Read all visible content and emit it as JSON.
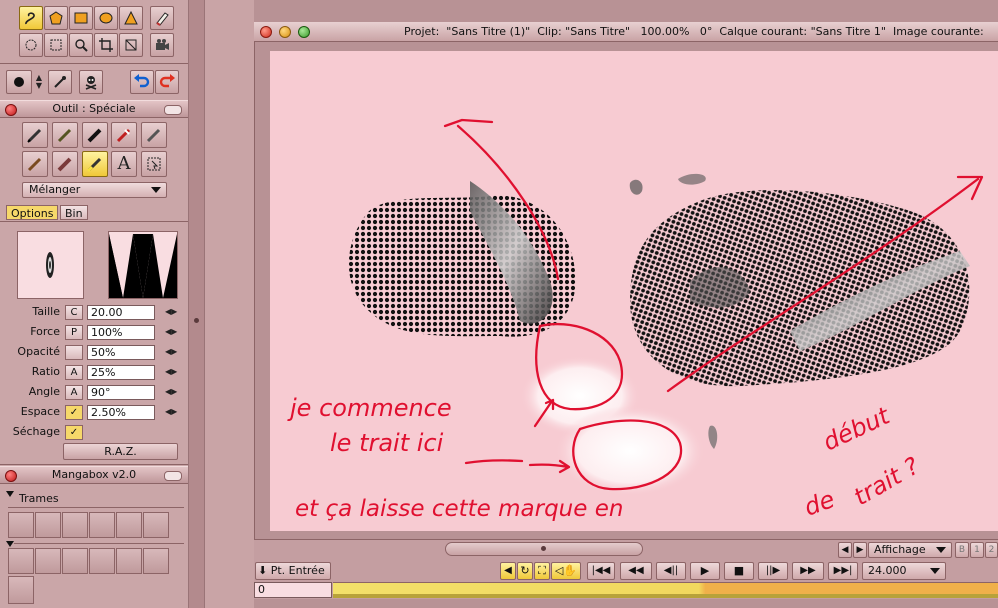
{
  "tools": {
    "row1": [
      "lasso-icon",
      "pentagon-icon",
      "rectangle-icon",
      "ellipse-icon",
      "triangle-icon",
      "eraser-icon"
    ],
    "row2": [
      "lasso-select-icon",
      "marquee-select-icon",
      "zoom-icon",
      "crop-icon",
      "transform-icon",
      "camera-icon"
    ],
    "row3": [
      "brush-size-icon",
      "swap-arrows-icon",
      "eyedropper-icon",
      "skull-icon",
      "undo-icon",
      "redo-icon"
    ]
  },
  "tool_panel": {
    "title": "Outil : Spéciale",
    "mode_select": "Mélanger",
    "tabs": [
      "Options",
      "Bin"
    ]
  },
  "params": [
    {
      "label": "Taille",
      "lock": "C",
      "value": "20.00"
    },
    {
      "label": "Force",
      "lock": "P",
      "value": "100%"
    },
    {
      "label": "Opacité",
      "lock": "",
      "value": "50%"
    },
    {
      "label": "Ratio",
      "lock": "A",
      "value": "25%"
    },
    {
      "label": "Angle",
      "lock": "A",
      "value": "90°"
    },
    {
      "label": "Espace",
      "lock": "✓",
      "value": "2.50%"
    },
    {
      "label": "Séchage",
      "lock": "✓",
      "value": ""
    }
  ],
  "reset_label": "R.A.Z.",
  "mangabox": {
    "title": "Mangabox v2.0",
    "section": "Trames"
  },
  "window": {
    "title": "Projet:  \"Sans Titre (1)\"  Clip: \"Sans Titre\"   100.00%   0°  Calque courant: \"Sans Titre 1\"  Image courante:"
  },
  "annotations": {
    "line1": "je commence",
    "line2": "le trait ici",
    "line3": "et ça laisse cette marque en",
    "word_debut": "début",
    "word_de": "de",
    "word_trait": "trait ?"
  },
  "viewbar": {
    "display_label": "Affichage",
    "frame_buttons": [
      "B",
      "1",
      "2"
    ]
  },
  "transport": {
    "in_point_label": "Pt. Entrée",
    "fps": "24.000",
    "frame": "0"
  },
  "colors": {
    "panel_bg": "#caa6a8",
    "canvas_bg": "#f7cbd2",
    "annotation_red": "#e01030",
    "selected_tool": "#f0c838"
  }
}
